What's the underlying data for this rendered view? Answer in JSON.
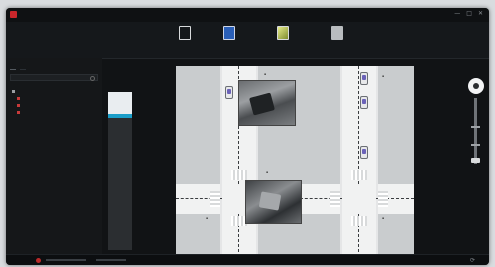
{
  "colors": {
    "accent": "#1b9ec9",
    "brand": "#c9262b",
    "road": "#f1f2f2",
    "block": "#c9ccce"
  },
  "window": {
    "title": "",
    "controls": [
      "—",
      "□",
      "✕"
    ]
  },
  "toolbar": {
    "items": [
      {
        "name": "toolbar-item-1",
        "label": "",
        "icon": "monitor-icon",
        "color": "#d8dadc"
      },
      {
        "name": "toolbar-item-2",
        "label": "",
        "icon": "map-icon",
        "color": "#2a5fb8"
      },
      {
        "name": "toolbar-item-3",
        "label": "",
        "icon": "image-icon",
        "color": "#bfc83a"
      },
      {
        "name": "toolbar-item-4",
        "label": "",
        "icon": "settings-icon",
        "color": "#b9bcbf"
      }
    ]
  },
  "left_panel": {
    "tabs": [
      "",
      ""
    ],
    "search": {
      "placeholder": "",
      "value": ""
    },
    "tree": [
      {
        "label": "",
        "color": "#9a9ea3",
        "indent": 0
      },
      {
        "label": "",
        "color": "#c73a3a",
        "indent": 1
      },
      {
        "label": "",
        "color": "#c73a3a",
        "indent": 1
      },
      {
        "label": "",
        "color": "#c73a3a",
        "indent": 1
      }
    ]
  },
  "status": {
    "icon": "refresh-icon"
  }
}
